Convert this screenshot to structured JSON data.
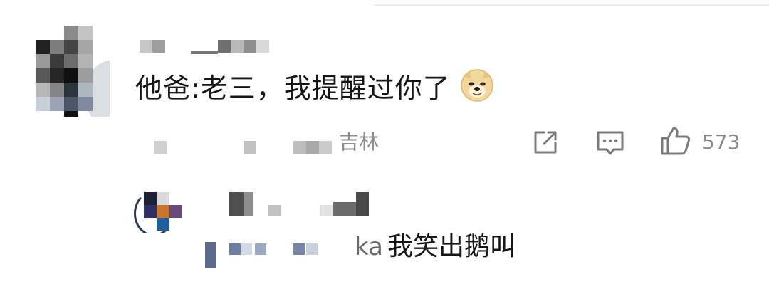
{
  "comment": {
    "text": "他爸:老三，我提醒过你了",
    "emoji_icon": "doge-emoji-icon",
    "location": "吉林",
    "like_count": "573"
  },
  "actions": {
    "share_icon": "share-icon",
    "reply_icon": "comment-icon",
    "like_icon": "thumbs-up-icon"
  },
  "reply": {
    "prefix": "ka",
    "text": "我笑出鹅叫"
  },
  "colors": {
    "text": "#161616",
    "meta": "#8c8c8c",
    "icon": "#7a7a7a"
  }
}
